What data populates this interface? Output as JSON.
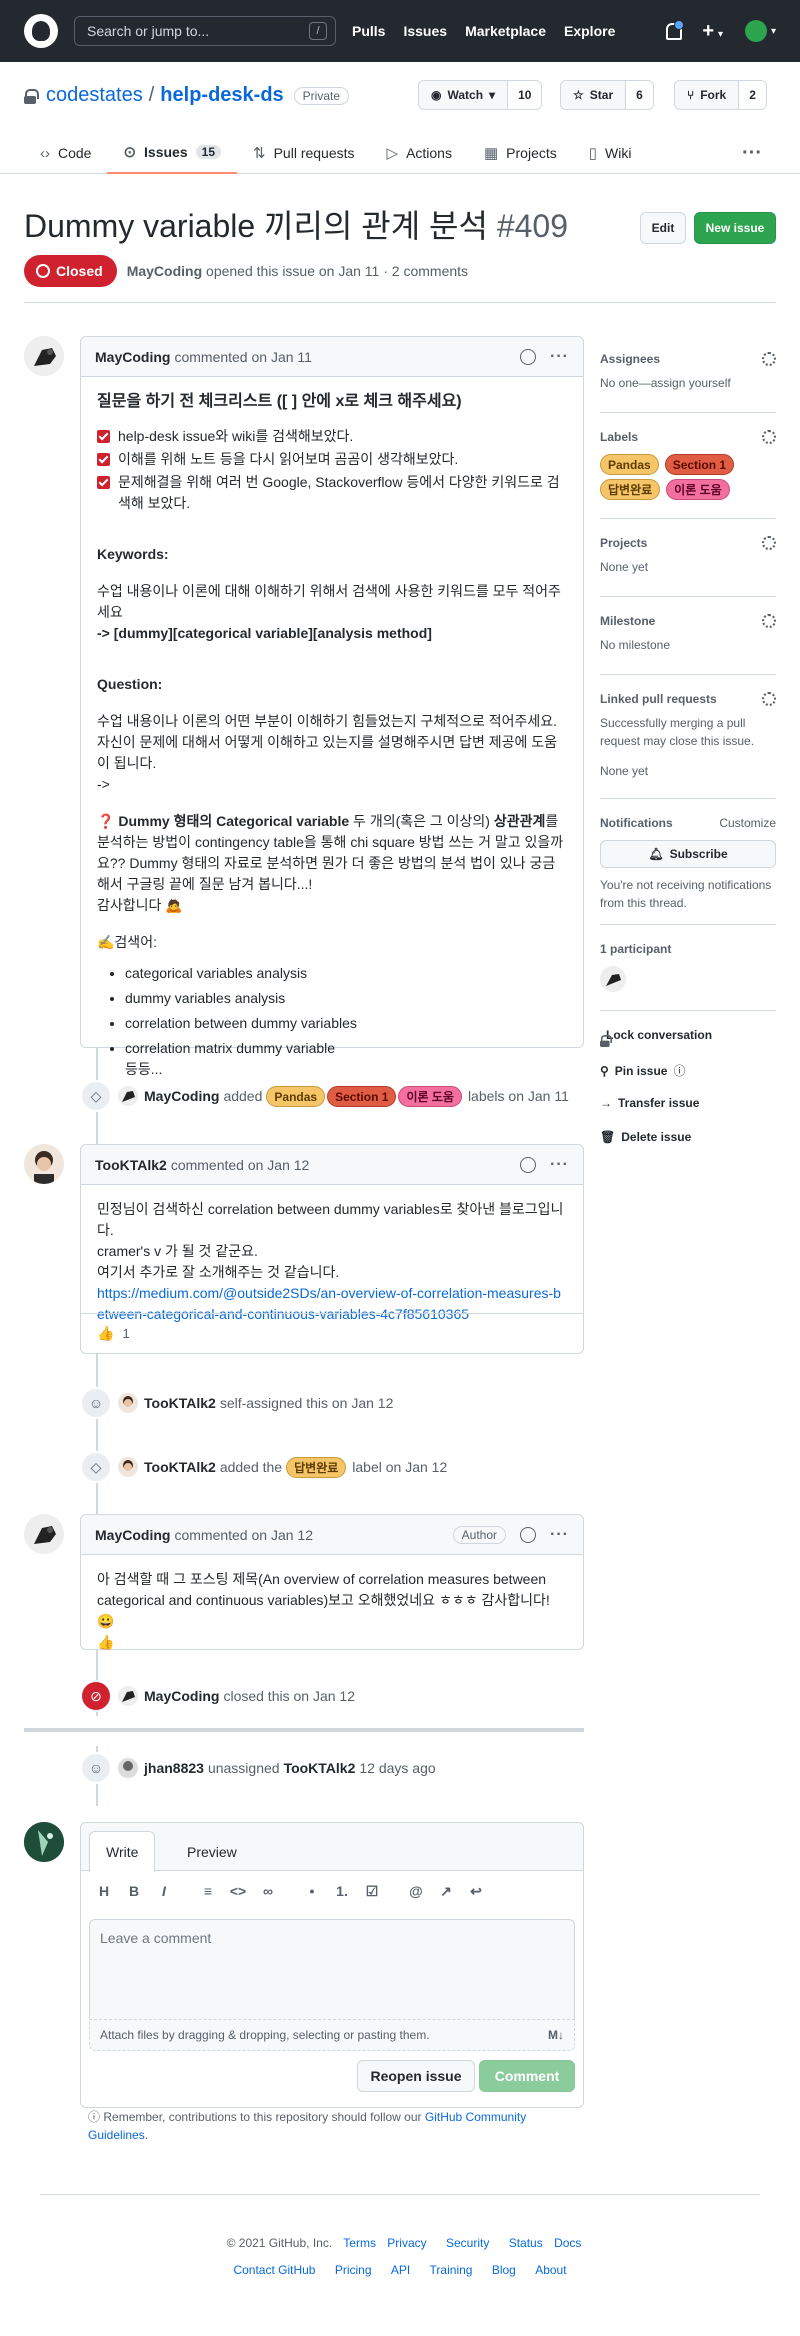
{
  "header": {
    "search_placeholder": "Search or jump to...",
    "search_key": "/",
    "nav": [
      "Pulls",
      "Issues",
      "Marketplace",
      "Explore"
    ],
    "plus": "+"
  },
  "repo": {
    "owner": "codestates",
    "separator": "/",
    "name": "help-desk-ds",
    "visibility": "Private",
    "watch_label": "Watch",
    "watch_count": "10",
    "star_label": "Star",
    "star_count": "6",
    "fork_label": "Fork",
    "fork_count": "2",
    "tabs": [
      {
        "label": "Code",
        "icon": "code-icon"
      },
      {
        "label": "Issues",
        "icon": "issue-icon",
        "count": "15"
      },
      {
        "label": "Pull requests",
        "icon": "pr-icon"
      },
      {
        "label": "Actions",
        "icon": "play-icon"
      },
      {
        "label": "Projects",
        "icon": "project-icon"
      },
      {
        "label": "Wiki",
        "icon": "book-icon"
      }
    ]
  },
  "issue": {
    "title": "Dummy variable 끼리의 관계 분석",
    "number": "#409",
    "edit_label": "Edit",
    "new_issue_label": "New issue",
    "state": "Closed",
    "author": "MayCoding",
    "meta": "opened this issue on Jan 11 · 2 comments"
  },
  "comments": {
    "first": {
      "author": "MayCoding",
      "when": "commented on Jan 11",
      "heading": "질문을 하기 전 체크리스트 ([ ] 안에 x로 체크 해주세요)",
      "checklist": [
        "help-desk issue와 wiki를 검색해보았다.",
        "이해를 위해 노트 등을 다시 읽어보며 곰곰이 생각해보았다.",
        "문제해결을 위해 여러 번 Google, Stackoverflow 등에서 다양한 키워드로 검색해 보았다."
      ],
      "keywords_title": "Keywords:",
      "keywords_desc": "수업 내용이나 이론에 대해 이해하기 위해서 검색에 사용한 키워드를 모두 적어주세요",
      "keywords_value": "-> [dummy][categorical variable][analysis method]",
      "question_title": "Question:",
      "question_desc": "수업 내용이나 이론의 어떤 부분이 이해하기 힘들었는지 구체적으로 적어주세요. 자신이 문제에 대해서 어떻게 이해하고 있는지를 설명해주시면 답변 제공에 도움이 됩니다.",
      "question_arrow": "->",
      "q_mark": "❓",
      "q_bold1": "Dummy 형태의 Categorical variable",
      "q_text1": " 두 개의(혹은 그 이상의) ",
      "q_bold2": "상관관계",
      "q_text2": "를 분석하는 방법이 contingency table을 통해 chi square 방법 쓰는 거 말고 있을까요?? Dummy 형태의 자료로 분석하면 뭔가 더 좋은 방법의 분석 법이 있나 궁금해서 구글링 끝에 질문 남겨 봅니다...!",
      "thanks": "감사합니다 🙇",
      "search_title": "✍️검색어:",
      "search_items": [
        "categorical variables analysis",
        "dummy variables analysis",
        "correlation between dummy variables",
        "correlation matrix dummy variable"
      ],
      "etc": "등등..."
    },
    "label_event": {
      "author": "MayCoding",
      "verb": "added",
      "labels": [
        "Pandas",
        "Section 1",
        "이론 도움"
      ],
      "suffix": "labels on Jan 11"
    },
    "second": {
      "author": "TooKTAlk2",
      "when": "commented on Jan 12",
      "line1": "민정님이 검색하신 correlation between dummy variables로 찾아낸 블로그입니다.",
      "line2": "cramer's v 가 될 것 같군요.",
      "line3": "여기서 추가로 잘 소개해주는 것 같습니다.",
      "link": "https://medium.com/@outside2SDs/an-overview-of-correlation-measures-between-categorical-and-continuous-variables-4c7f85610365",
      "reaction_emoji": "👍",
      "reaction_count": "1"
    },
    "assign_event": {
      "author": "TooKTAlk2",
      "text": "self-assigned this on Jan 12"
    },
    "label_event2": {
      "author": "TooKTAlk2",
      "verb": "added the",
      "label": "답변완료",
      "suffix": "label on Jan 12"
    },
    "third": {
      "author": "MayCoding",
      "when": "commented on Jan 12",
      "badge": "Author",
      "text": "아 검색할 때 그 포스팅 제목(An overview of correlation measures between categorical and continuous variables)보고 오해했었네요 ㅎㅎㅎ 감사합니다!😀",
      "emoji": "👍"
    },
    "closed_event": {
      "author": "MayCoding",
      "text": "closed this on Jan 12"
    },
    "unassign_event": {
      "author": "jhan8823",
      "verb": "unassigned",
      "target": "TooKTAlk2",
      "when": "12 days ago"
    }
  },
  "sidebar": {
    "assignees_title": "Assignees",
    "assignees_value": "No one—assign yourself",
    "labels_title": "Labels",
    "labels": [
      "Pandas",
      "Section 1",
      "답변완료",
      "이론 도움"
    ],
    "projects_title": "Projects",
    "projects_value": "None yet",
    "milestone_title": "Milestone",
    "milestone_value": "No milestone",
    "linked_title": "Linked pull requests",
    "linked_desc": "Successfully merging a pull request may close this issue.",
    "linked_value": "None yet",
    "notifications_title": "Notifications",
    "customize": "Customize",
    "subscribe": "Subscribe",
    "notif_desc": "You're not receiving notifications from this thread.",
    "participants": "1 participant",
    "lock": "Lock conversation",
    "pin": "Pin issue",
    "transfer": "Transfer issue",
    "delete": "Delete issue"
  },
  "editor": {
    "write": "Write",
    "preview": "Preview",
    "placeholder": "Leave a comment",
    "attach": "Attach files by dragging & dropping, selecting or pasting them.",
    "reopen": "Reopen issue",
    "comment": "Comment",
    "toolbar": [
      "H",
      "B",
      "I",
      "≡",
      "<>",
      "∞",
      "•",
      "1.",
      "☑",
      "@",
      "↗",
      "↩"
    ],
    "note_prefix": "Remember, contributions to this repository should follow our",
    "note_link": "GitHub Community Guidelines",
    "note_suffix": "."
  },
  "footer": {
    "copyright": "© 2021 GitHub, Inc.",
    "row1": [
      "Terms",
      "Privacy",
      "Security",
      "Status",
      "Docs"
    ],
    "row2": [
      "Contact GitHub",
      "Pricing",
      "API",
      "Training",
      "Blog",
      "About"
    ]
  },
  "colors": {
    "closed": "#cf222e",
    "green": "#2da44e",
    "link": "#0969da",
    "header_bg": "#24292f"
  }
}
